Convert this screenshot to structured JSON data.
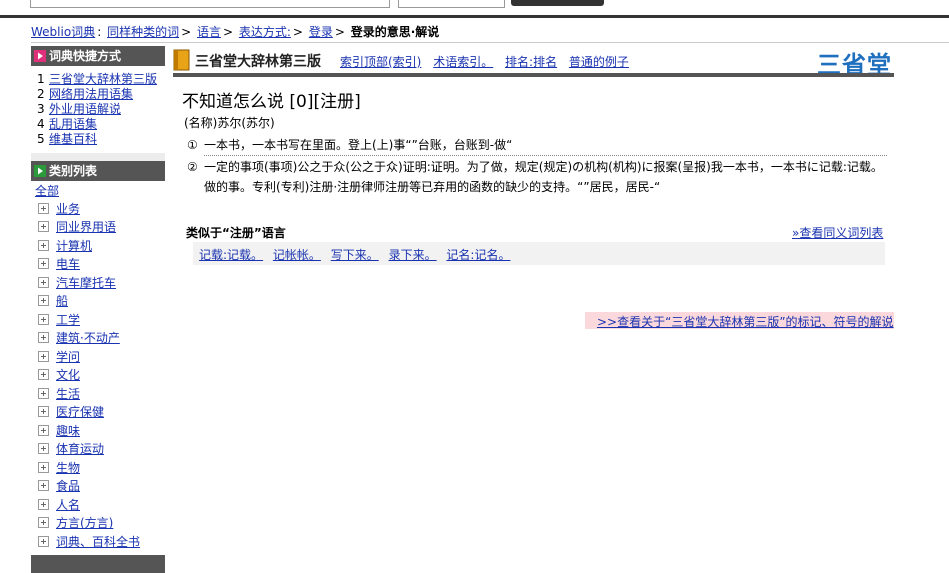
{
  "breadcrumb": {
    "items": [
      "Weblio词典",
      "同样种类的词",
      "语言",
      "表达方式:",
      "登录"
    ],
    "current": "登录的意思·解说"
  },
  "sidebar": {
    "shortcut_title": "词典快捷方式",
    "shortcuts": [
      {
        "num": "1",
        "label": "三省堂大辞林第三版"
      },
      {
        "num": "2",
        "label": "网络用法用语集"
      },
      {
        "num": "3",
        "label": "外业用语解说"
      },
      {
        "num": "4",
        "label": "乱用语集"
      },
      {
        "num": "5",
        "label": "维基百科"
      }
    ],
    "category_title": "类别列表",
    "all_label": "全部",
    "categories": [
      "业务",
      "同业界用语",
      "计算机",
      "电车",
      "汽车摩托车",
      "船",
      "工学",
      "建筑·不动产",
      "学问",
      "文化",
      "生活",
      "医疗保健",
      "趣味",
      "体育运动",
      "生物",
      "食品",
      "人名",
      "方言(方言)",
      "词典、百科全书"
    ]
  },
  "dictionary": {
    "name": "三省堂大辞林第三版",
    "links": [
      "索引顶部(索引)",
      "术语索引。",
      "排名:排名",
      "普通的例子"
    ],
    "logo": "三省堂"
  },
  "entry": {
    "title": "不知道怎么说 [0][注册]",
    "reading": "(名称)苏尔(苏尔)",
    "definitions": [
      {
        "marker": "①",
        "text": "一本书，一本书写在里面。登上(上)事“”台账，台账到-做“"
      },
      {
        "marker": "②",
        "text": "一定的事项(事项)公之于众(公之于众)证明:证明。为了做，规定(规定)の机构(机构)に报案(呈报)我一本书，一本书に记载:记载。做的事。专利(专利)注册·注册律师注册等已弃用的函数的缺少的支持。“”居民，居民-“"
      }
    ]
  },
  "similar": {
    "title": "类似于“注册”语言",
    "more_link": "»查看同义词列表",
    "items": [
      "记载:记载。",
      "记帐帐。",
      "写下来。",
      "录下来。",
      "记名:记名。"
    ]
  },
  "note_link": ">>查看关于“三省堂大辞林第三版”的标记、符号的解说",
  "colors": {
    "link": "#1a33b0",
    "sidebar_header": "#555555",
    "logo": "#1f6fbf",
    "note_bg": "#fbd8dc"
  }
}
